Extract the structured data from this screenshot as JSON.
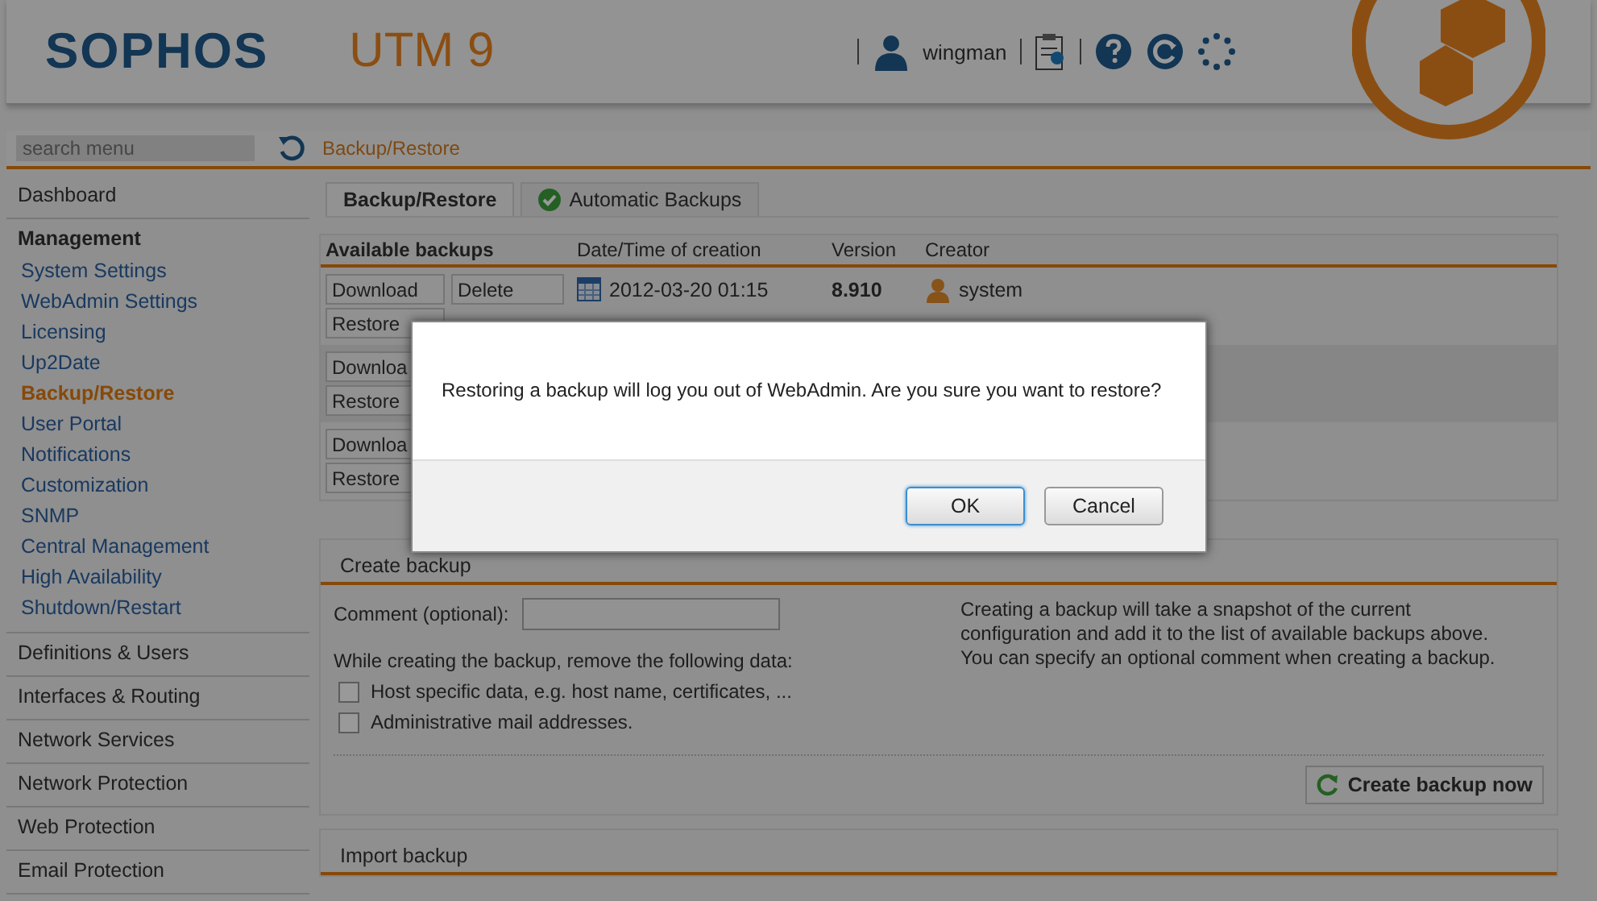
{
  "header": {
    "logo": "SOPHOS",
    "product": "UTM 9",
    "user": "wingman"
  },
  "search": {
    "placeholder": "search menu"
  },
  "breadcrumb": "Backup/Restore",
  "sidebar": [
    {
      "label": "Dashboard"
    },
    {
      "label": "Management",
      "children": [
        {
          "label": "System Settings",
          "selected": false
        },
        {
          "label": "WebAdmin Settings",
          "selected": false
        },
        {
          "label": "Licensing",
          "selected": false
        },
        {
          "label": "Up2Date",
          "selected": false
        },
        {
          "label": "Backup/Restore",
          "selected": true
        },
        {
          "label": "User Portal",
          "selected": false
        },
        {
          "label": "Notifications",
          "selected": false
        },
        {
          "label": "Customization",
          "selected": false
        },
        {
          "label": "SNMP",
          "selected": false
        },
        {
          "label": "Central Management",
          "selected": false
        },
        {
          "label": "High Availability",
          "selected": false
        },
        {
          "label": "Shutdown/Restart",
          "selected": false
        }
      ]
    },
    {
      "label": "Definitions & Users"
    },
    {
      "label": "Interfaces & Routing"
    },
    {
      "label": "Network Services"
    },
    {
      "label": "Network Protection"
    },
    {
      "label": "Web Protection"
    },
    {
      "label": "Email Protection"
    }
  ],
  "tabs": [
    {
      "label": "Backup/Restore",
      "selected": true,
      "enabled": false
    },
    {
      "label": "Automatic Backups",
      "selected": false,
      "enabled": true
    }
  ],
  "backups": {
    "columns": [
      "Available backups",
      "Date/Time of creation",
      "Version",
      "Creator"
    ],
    "rows": [
      {
        "buttons": [
          "Download",
          "Restore",
          "Delete"
        ],
        "date": "2012-03-20 01:15",
        "version": "8.910",
        "creator": "system"
      },
      {
        "buttons": [
          "Downloa",
          "Restore"
        ]
      },
      {
        "buttons": [
          "Downloa",
          "Restore"
        ]
      }
    ]
  },
  "create_backup": {
    "title": "Create backup",
    "comment_label": "Comment (optional):",
    "remove_label": "While creating the backup, remove the following data:",
    "options": [
      {
        "label": "Host specific data, e.g. host name, certificates, ...",
        "checked": false
      },
      {
        "label": "Administrative mail addresses.",
        "checked": false
      }
    ],
    "help": "Creating a backup will take a snapshot of the current configuration and add it to the list of available backups above. You can specify an optional comment when creating a backup.",
    "button": "Create backup now"
  },
  "import_backup": {
    "title": "Import backup"
  },
  "dialog": {
    "message": "Restoring a backup will log you out of WebAdmin. Are you sure you want to restore?",
    "buttons": [
      {
        "label": "OK",
        "default": true
      },
      {
        "label": "Cancel",
        "default": false
      }
    ]
  }
}
